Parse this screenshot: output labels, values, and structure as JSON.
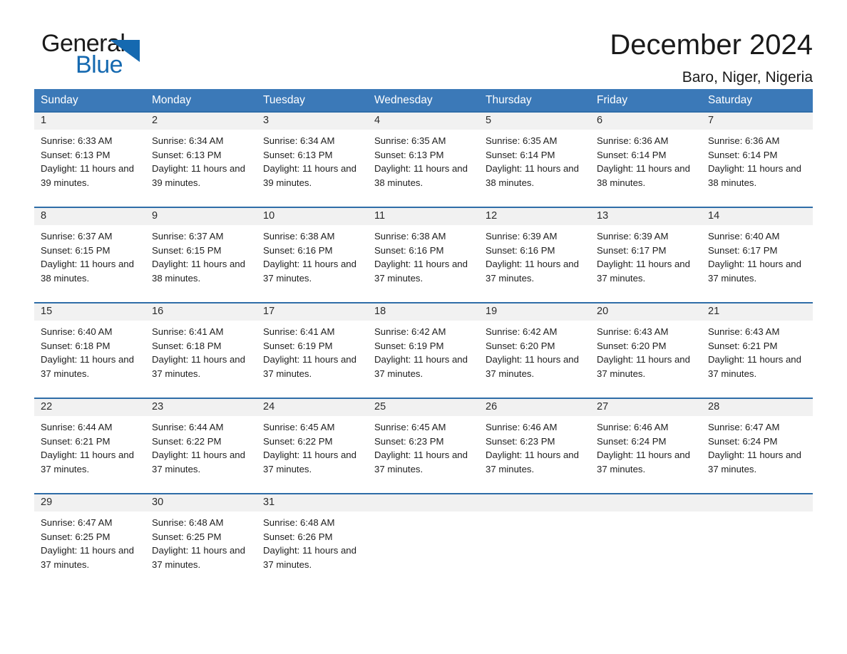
{
  "brand": {
    "name_part1": "General",
    "name_part2": "Blue",
    "triangle_color": "#1569b0"
  },
  "header": {
    "title": "December 2024",
    "subtitle": "Baro, Niger, Nigeria"
  },
  "theme": {
    "header_blue": "#3b79b8",
    "row_border_blue": "#2f6da8",
    "day_band_gray": "#f1f1f1",
    "text_dark": "#1e1e1e"
  },
  "weekdays": [
    "Sunday",
    "Monday",
    "Tuesday",
    "Wednesday",
    "Thursday",
    "Friday",
    "Saturday"
  ],
  "weeks": [
    [
      {
        "day": "1",
        "sunrise": "Sunrise: 6:33 AM",
        "sunset": "Sunset: 6:13 PM",
        "daylight": "Daylight: 11 hours and 39 minutes."
      },
      {
        "day": "2",
        "sunrise": "Sunrise: 6:34 AM",
        "sunset": "Sunset: 6:13 PM",
        "daylight": "Daylight: 11 hours and 39 minutes."
      },
      {
        "day": "3",
        "sunrise": "Sunrise: 6:34 AM",
        "sunset": "Sunset: 6:13 PM",
        "daylight": "Daylight: 11 hours and 39 minutes."
      },
      {
        "day": "4",
        "sunrise": "Sunrise: 6:35 AM",
        "sunset": "Sunset: 6:13 PM",
        "daylight": "Daylight: 11 hours and 38 minutes."
      },
      {
        "day": "5",
        "sunrise": "Sunrise: 6:35 AM",
        "sunset": "Sunset: 6:14 PM",
        "daylight": "Daylight: 11 hours and 38 minutes."
      },
      {
        "day": "6",
        "sunrise": "Sunrise: 6:36 AM",
        "sunset": "Sunset: 6:14 PM",
        "daylight": "Daylight: 11 hours and 38 minutes."
      },
      {
        "day": "7",
        "sunrise": "Sunrise: 6:36 AM",
        "sunset": "Sunset: 6:14 PM",
        "daylight": "Daylight: 11 hours and 38 minutes."
      }
    ],
    [
      {
        "day": "8",
        "sunrise": "Sunrise: 6:37 AM",
        "sunset": "Sunset: 6:15 PM",
        "daylight": "Daylight: 11 hours and 38 minutes."
      },
      {
        "day": "9",
        "sunrise": "Sunrise: 6:37 AM",
        "sunset": "Sunset: 6:15 PM",
        "daylight": "Daylight: 11 hours and 38 minutes."
      },
      {
        "day": "10",
        "sunrise": "Sunrise: 6:38 AM",
        "sunset": "Sunset: 6:16 PM",
        "daylight": "Daylight: 11 hours and 37 minutes."
      },
      {
        "day": "11",
        "sunrise": "Sunrise: 6:38 AM",
        "sunset": "Sunset: 6:16 PM",
        "daylight": "Daylight: 11 hours and 37 minutes."
      },
      {
        "day": "12",
        "sunrise": "Sunrise: 6:39 AM",
        "sunset": "Sunset: 6:16 PM",
        "daylight": "Daylight: 11 hours and 37 minutes."
      },
      {
        "day": "13",
        "sunrise": "Sunrise: 6:39 AM",
        "sunset": "Sunset: 6:17 PM",
        "daylight": "Daylight: 11 hours and 37 minutes."
      },
      {
        "day": "14",
        "sunrise": "Sunrise: 6:40 AM",
        "sunset": "Sunset: 6:17 PM",
        "daylight": "Daylight: 11 hours and 37 minutes."
      }
    ],
    [
      {
        "day": "15",
        "sunrise": "Sunrise: 6:40 AM",
        "sunset": "Sunset: 6:18 PM",
        "daylight": "Daylight: 11 hours and 37 minutes."
      },
      {
        "day": "16",
        "sunrise": "Sunrise: 6:41 AM",
        "sunset": "Sunset: 6:18 PM",
        "daylight": "Daylight: 11 hours and 37 minutes."
      },
      {
        "day": "17",
        "sunrise": "Sunrise: 6:41 AM",
        "sunset": "Sunset: 6:19 PM",
        "daylight": "Daylight: 11 hours and 37 minutes."
      },
      {
        "day": "18",
        "sunrise": "Sunrise: 6:42 AM",
        "sunset": "Sunset: 6:19 PM",
        "daylight": "Daylight: 11 hours and 37 minutes."
      },
      {
        "day": "19",
        "sunrise": "Sunrise: 6:42 AM",
        "sunset": "Sunset: 6:20 PM",
        "daylight": "Daylight: 11 hours and 37 minutes."
      },
      {
        "day": "20",
        "sunrise": "Sunrise: 6:43 AM",
        "sunset": "Sunset: 6:20 PM",
        "daylight": "Daylight: 11 hours and 37 minutes."
      },
      {
        "day": "21",
        "sunrise": "Sunrise: 6:43 AM",
        "sunset": "Sunset: 6:21 PM",
        "daylight": "Daylight: 11 hours and 37 minutes."
      }
    ],
    [
      {
        "day": "22",
        "sunrise": "Sunrise: 6:44 AM",
        "sunset": "Sunset: 6:21 PM",
        "daylight": "Daylight: 11 hours and 37 minutes."
      },
      {
        "day": "23",
        "sunrise": "Sunrise: 6:44 AM",
        "sunset": "Sunset: 6:22 PM",
        "daylight": "Daylight: 11 hours and 37 minutes."
      },
      {
        "day": "24",
        "sunrise": "Sunrise: 6:45 AM",
        "sunset": "Sunset: 6:22 PM",
        "daylight": "Daylight: 11 hours and 37 minutes."
      },
      {
        "day": "25",
        "sunrise": "Sunrise: 6:45 AM",
        "sunset": "Sunset: 6:23 PM",
        "daylight": "Daylight: 11 hours and 37 minutes."
      },
      {
        "day": "26",
        "sunrise": "Sunrise: 6:46 AM",
        "sunset": "Sunset: 6:23 PM",
        "daylight": "Daylight: 11 hours and 37 minutes."
      },
      {
        "day": "27",
        "sunrise": "Sunrise: 6:46 AM",
        "sunset": "Sunset: 6:24 PM",
        "daylight": "Daylight: 11 hours and 37 minutes."
      },
      {
        "day": "28",
        "sunrise": "Sunrise: 6:47 AM",
        "sunset": "Sunset: 6:24 PM",
        "daylight": "Daylight: 11 hours and 37 minutes."
      }
    ],
    [
      {
        "day": "29",
        "sunrise": "Sunrise: 6:47 AM",
        "sunset": "Sunset: 6:25 PM",
        "daylight": "Daylight: 11 hours and 37 minutes."
      },
      {
        "day": "30",
        "sunrise": "Sunrise: 6:48 AM",
        "sunset": "Sunset: 6:25 PM",
        "daylight": "Daylight: 11 hours and 37 minutes."
      },
      {
        "day": "31",
        "sunrise": "Sunrise: 6:48 AM",
        "sunset": "Sunset: 6:26 PM",
        "daylight": "Daylight: 11 hours and 37 minutes."
      },
      {
        "day": "",
        "sunrise": "",
        "sunset": "",
        "daylight": ""
      },
      {
        "day": "",
        "sunrise": "",
        "sunset": "",
        "daylight": ""
      },
      {
        "day": "",
        "sunrise": "",
        "sunset": "",
        "daylight": ""
      },
      {
        "day": "",
        "sunrise": "",
        "sunset": "",
        "daylight": ""
      }
    ]
  ]
}
